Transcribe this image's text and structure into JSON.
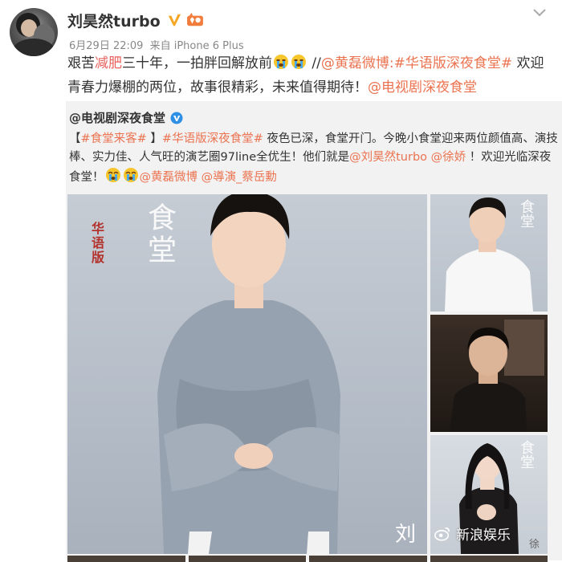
{
  "post": {
    "author": "刘昊然turbo",
    "date": "6月29日 22:09",
    "source_prefix": "来自",
    "source": "iPhone 6 Plus",
    "text_part1": "艰苦",
    "text_highlight": "减肥",
    "text_part2": "三十年，一拍胖回解放前",
    "text_sep": " //",
    "mention_huanglei": "@黄磊微博",
    "text_colon": ":",
    "hashtag_main": "#华语版深夜食堂#",
    "text_part3": " 欢迎青春力爆棚的两位，故事很精彩，未来值得期待！",
    "mention_show": "@电视剧深夜食堂"
  },
  "repost": {
    "author": "@电视剧深夜食堂",
    "bracket_open": "【",
    "tag_cafeteria": "#食堂来客#",
    "bracket_close": " 】",
    "hashtag_main": "#华语版深夜食堂#",
    "text_part1": " 夜色已深，食堂开门。今晚小食堂迎来两位颜值高、演技棒、实力佳、人气旺的演艺圈97line全优生！他们就是",
    "mention_liu": "@刘昊然turbo",
    "space": " ",
    "mention_xu": "@徐娇",
    "text_part2": " ！欢迎光临深夜食堂！",
    "mention_huanglei": "@黄磊微博",
    "mention_director": "@導演_蔡岳勳"
  },
  "poster": {
    "title": "食堂",
    "version": "华语版",
    "corner": "刘",
    "side_title": "食堂",
    "side_corner": "徐"
  },
  "watermark": "新浪娱乐",
  "colors": {
    "link": "#eb7350",
    "highlight": "#e8615c",
    "vip_badge": "#f5a623",
    "verified": "#2d8fe6",
    "repost_bg": "#f2f2f2"
  },
  "icons": {
    "vip": "verified-v-icon",
    "fan": "fan-club-icon",
    "more": "chevron-down-icon",
    "emoji": "crying-emoji-icon",
    "weibo": "weibo-logo-icon"
  }
}
